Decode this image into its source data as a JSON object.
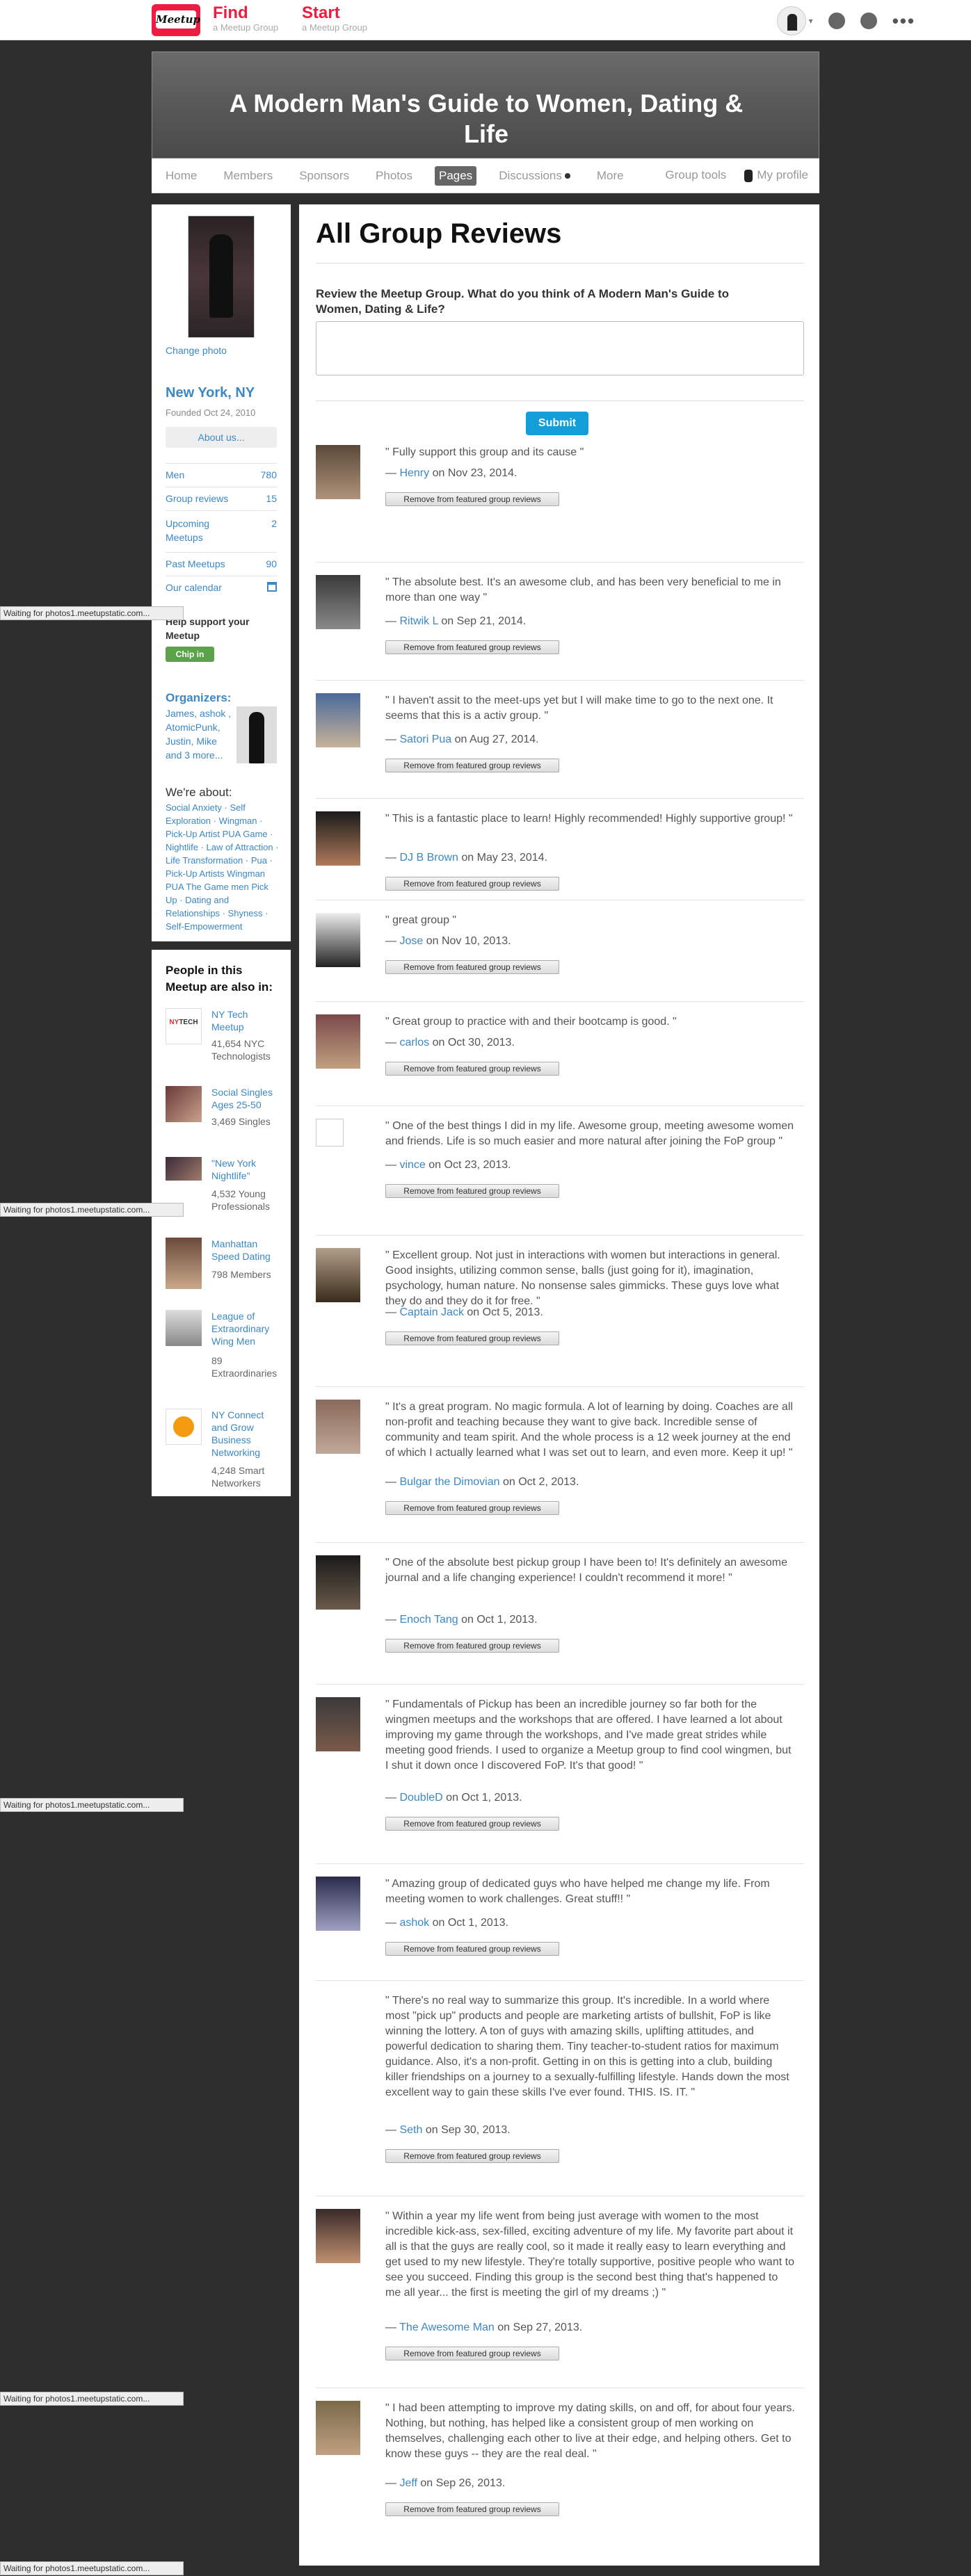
{
  "topbar": {
    "logo_text": "Meetup",
    "find_label": "Find",
    "find_sub": "a Meetup Group",
    "start_label": "Start",
    "start_sub": "a Meetup Group"
  },
  "banner": {
    "title": "A Modern Man's Guide to Women, Dating & Life"
  },
  "groupnav": {
    "items": [
      "Home",
      "Members",
      "Sponsors",
      "Photos",
      "Pages",
      "Discussions",
      "More"
    ],
    "active": "Pages",
    "group_tools": "Group tools",
    "my_profile": "My profile"
  },
  "sidebar": {
    "change_photo": "Change photo",
    "city": "New York, NY",
    "founded": "Founded Oct 24, 2010",
    "about_us": "About us...",
    "stats": [
      {
        "label": "Men",
        "value": "780"
      },
      {
        "label": "Group reviews",
        "value": "15"
      },
      {
        "label": "Upcoming Meetups",
        "value": "2"
      },
      {
        "label": "Past Meetups",
        "value": "90"
      },
      {
        "label": "Our calendar",
        "value": ""
      }
    ],
    "help": "Help support your Meetup",
    "chip_in": "Chip in",
    "organizers_heading": "Organizers:",
    "organizers": "James, ashok , AtomicPunk, Justin, Mike and 3 more...",
    "about_heading": "We're about:",
    "topics": "Social Anxiety · Self Exploration · Wingman · Pick-Up Artist PUA Game · Nightlife · Law of Attraction · Life Transformation · Pua · Pick-Up Artists Wingman PUA The Game men Pick Up · Dating and Relationships · Shyness · Self-Empowerment"
  },
  "also_in": {
    "heading": "People in this Meetup are also in:",
    "groups": [
      {
        "name": "NY Tech Meetup",
        "count": "41,654 NYC Technologists"
      },
      {
        "name": "Social Singles Ages 25-50",
        "count": "3,469 Singles"
      },
      {
        "name": "\"New York Nightlife\"",
        "count": "4,532 Young Professionals"
      },
      {
        "name": "Manhattan Speed Dating",
        "count": "798 Members"
      },
      {
        "name": "League of Extraordinary Wing Men",
        "count": "89 Extraordinaries"
      },
      {
        "name": "NY Connect and Grow Business Networking",
        "count": "4,248 Smart Networkers"
      }
    ]
  },
  "main": {
    "title": "All Group Reviews",
    "prompt": "Review the Meetup Group. What do you think of A Modern Man's Guide to Women, Dating & Life?",
    "textarea_value": "",
    "submit": "Submit",
    "remove_label": "Remove from featured group reviews",
    "reviews": [
      {
        "text": "\" Fully support this group and its cause \"",
        "author": "Henry",
        "date": " on Nov 23, 2014."
      },
      {
        "text": "\" The absolute best. It's an awesome club, and has been very beneficial to me in more than one way \"",
        "author": "Ritwik L",
        "date": " on Sep 21, 2014."
      },
      {
        "text": "\" I haven't assit to the meet-ups yet but I will make time to go to the next one. It seems that this is a activ group. \"",
        "author": "Satori Pua",
        "date": " on Aug 27, 2014."
      },
      {
        "text": "\" This is a fantastic place to learn! Highly recommended! Highly supportive group! \"",
        "author": "DJ B Brown",
        "date": " on May 23, 2014."
      },
      {
        "text": "\" great group \"",
        "author": "Jose",
        "date": " on Nov 10, 2013."
      },
      {
        "text": "\" Great group to practice with and their bootcamp is good. \"",
        "author": "carlos",
        "date": " on Oct 30, 2013."
      },
      {
        "text": "\" One of the best things I did in my life. Awesome group, meeting awesome women and friends. Life is so much easier and more natural after joining the FoP group \"",
        "author": "vince",
        "date": " on Oct 23, 2013."
      },
      {
        "text": "\" Excellent group. Not just in interactions with women but interactions in general. Good insights, utilizing common sense, balls (just going for it), imagination, psychology, human nature. No nonsense sales gimmicks. These guys love what they do and they do it for free. \"",
        "author": "Captain Jack",
        "date": " on Oct 5, 2013."
      },
      {
        "text": "\" It's a great program. No magic formula. A lot of learning by doing. Coaches are all non-profit and teaching because they want to give back. Incredible sense of community and team spirit. And the whole process is a 12 week journey at the end of which I actually learned what I was set out to learn, and even more. Keep it up! \"",
        "author": "Bulgar the Dimovian",
        "date": " on Oct 2, 2013."
      },
      {
        "text": "\" One of the absolute best pickup group I have been to! It's definitely an awesome journal and a life changing experience! I couldn't recommend it more! \"",
        "author": "Enoch Tang",
        "date": " on Oct 1, 2013."
      },
      {
        "text": "\" Fundamentals of Pickup has been an incredible journey so far both for the wingmen meetups and the workshops that are offered. I have learned a lot about improving my game through the workshops, and I've made great strides while meeting good friends. I used to organize a Meetup group to find cool wingmen, but I shut it down once I discovered FoP. It's that good! \"",
        "author": "DoubleD",
        "date": " on Oct 1, 2013."
      },
      {
        "text": "\" Amazing group of dedicated guys who have helped me change my life. From meeting women to work challenges. Great stuff!! \"",
        "author": "ashok",
        "date": " on Oct 1, 2013."
      },
      {
        "text": "\" There's no real way to summarize this group. It's incredible. In a world where most \"pick up\" products and people are marketing artists of bullshit, FoP is like winning the lottery. A ton of guys with amazing skills, uplifting attitudes, and powerful dedication to sharing them. Tiny teacher-to-student ratios for maximum guidance. Also, it's a non-profit. Getting in on this is getting into a club, building killer friendships on a journey to a sexually-fulfilling lifestyle. Hands down the most excellent way to gain these skills I've ever found. THIS. IS. IT. \"",
        "author": "Seth",
        "date": " on Sep 30, 2013."
      },
      {
        "text": "\" Within a year my life went from being just average with women to the most incredible kick-ass, sex-filled, exciting adventure of my life. My favorite part about it all is that the guys are really cool, so it made it really easy to learn everything and get used to my new lifestyle. They're totally supportive, positive people who want to see you succeed. Finding this group is the second best thing that's happened to me all year... the first is meeting the girl of my dreams ;) \"",
        "author": "The Awesome Man",
        "date": " on Sep 27, 2013."
      },
      {
        "text": "\" I had been attempting to improve my dating skills, on and off, for about four years. Nothing, but nothing, has helped like a consistent group of men working on themselves, challenging each other to live at their edge, and helping others. Get to know these guys -- they are the real deal. \"",
        "author": "Jeff",
        "date": " on Sep 26, 2013."
      }
    ]
  },
  "waiting": "Waiting for photos1.meetupstatic.com..."
}
